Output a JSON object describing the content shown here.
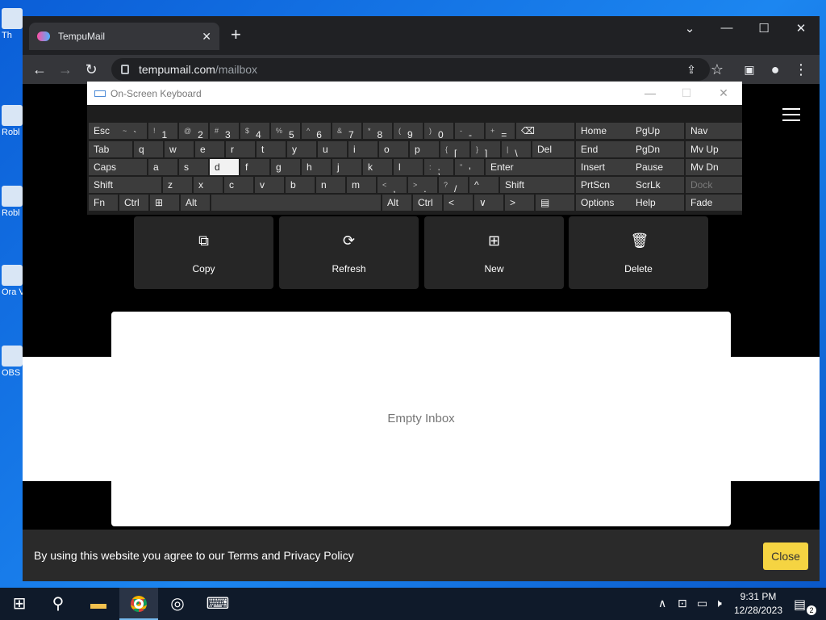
{
  "desktop": {
    "icons": [
      {
        "label": "Th"
      },
      {
        "label": "Robl"
      },
      {
        "label": "Robl"
      },
      {
        "label": "Ora Virt"
      },
      {
        "label": "OBS"
      }
    ]
  },
  "browser": {
    "tab_title": "TempuMail",
    "tab_close": "✕",
    "new_tab": "+",
    "url_host": "tempumail.com",
    "url_path": "/mailbox"
  },
  "osk": {
    "title": "On-Screen Keyboard",
    "rows": [
      [
        {
          "label": "Esc"
        },
        {
          "shift": "~",
          "label": "`"
        },
        {
          "shift": "!",
          "label": "1"
        },
        {
          "shift": "@",
          "label": "2"
        },
        {
          "shift": "#",
          "label": "3"
        },
        {
          "shift": "$",
          "label": "4"
        },
        {
          "shift": "%",
          "label": "5"
        },
        {
          "shift": "^",
          "label": "6"
        },
        {
          "shift": "&",
          "label": "7"
        },
        {
          "shift": "*",
          "label": "8"
        },
        {
          "shift": "(",
          "label": "9"
        },
        {
          "shift": ")",
          "label": "0"
        },
        {
          "shift": "-",
          "label": "-"
        },
        {
          "shift": "+",
          "label": "="
        },
        {
          "label": "⌫"
        }
      ],
      [
        {
          "label": "Tab"
        },
        {
          "label": "q"
        },
        {
          "label": "w"
        },
        {
          "label": "e"
        },
        {
          "label": "r"
        },
        {
          "label": "t"
        },
        {
          "label": "y"
        },
        {
          "label": "u"
        },
        {
          "label": "i"
        },
        {
          "label": "o"
        },
        {
          "label": "p"
        },
        {
          "shift": "{",
          "label": "["
        },
        {
          "shift": "}",
          "label": "]"
        },
        {
          "shift": "|",
          "label": "\\"
        },
        {
          "label": "Del"
        }
      ],
      [
        {
          "label": "Caps"
        },
        {
          "label": "a"
        },
        {
          "label": "s"
        },
        {
          "label": "d"
        },
        {
          "label": "f"
        },
        {
          "label": "g"
        },
        {
          "label": "h"
        },
        {
          "label": "j"
        },
        {
          "label": "k"
        },
        {
          "label": "l"
        },
        {
          "shift": ":",
          "label": ";"
        },
        {
          "shift": "\"",
          "label": "'"
        },
        {
          "label": "Enter"
        }
      ],
      [
        {
          "label": "Shift"
        },
        {
          "label": "z"
        },
        {
          "label": "x"
        },
        {
          "label": "c"
        },
        {
          "label": "v"
        },
        {
          "label": "b"
        },
        {
          "label": "n"
        },
        {
          "label": "m"
        },
        {
          "shift": "<",
          "label": ","
        },
        {
          "shift": ">",
          "label": "."
        },
        {
          "shift": "?",
          "label": "/"
        },
        {
          "label": "^"
        },
        {
          "label": "Shift"
        }
      ],
      [
        {
          "label": "Fn"
        },
        {
          "label": "Ctrl"
        },
        {
          "label": "⊞"
        },
        {
          "label": "Alt"
        },
        {
          "label": ""
        },
        {
          "label": "Alt"
        },
        {
          "label": "Ctrl"
        },
        {
          "label": "<"
        },
        {
          "label": "∨"
        },
        {
          "label": ">"
        },
        {
          "label": "▤"
        }
      ]
    ],
    "nav_keys": [
      [
        "Home",
        "PgUp",
        "Nav"
      ],
      [
        "End",
        "PgDn",
        "Mv Up"
      ],
      [
        "Insert",
        "Pause",
        "Mv Dn"
      ],
      [
        "PrtScn",
        "ScrLk",
        "Dock"
      ],
      [
        "Options",
        "Help",
        "Fade"
      ]
    ],
    "pressed_key": "d"
  },
  "page": {
    "actions": [
      {
        "label": "Copy",
        "icon": "copy-icon"
      },
      {
        "label": "Refresh",
        "icon": "refresh-icon"
      },
      {
        "label": "New",
        "icon": "new-icon"
      },
      {
        "label": "Delete",
        "icon": "trash-icon"
      }
    ],
    "empty_inbox": "Empty Inbox",
    "cookie_text": "By using this website you agree to our Terms and Privacy Policy",
    "cookie_close": "Close"
  },
  "taskbar": {
    "time": "9:31 PM",
    "date": "12/28/2023",
    "notification_count": "2"
  },
  "colors": {
    "cookie_button": "#f5d442",
    "desktop_blue": "#1c86f0"
  }
}
